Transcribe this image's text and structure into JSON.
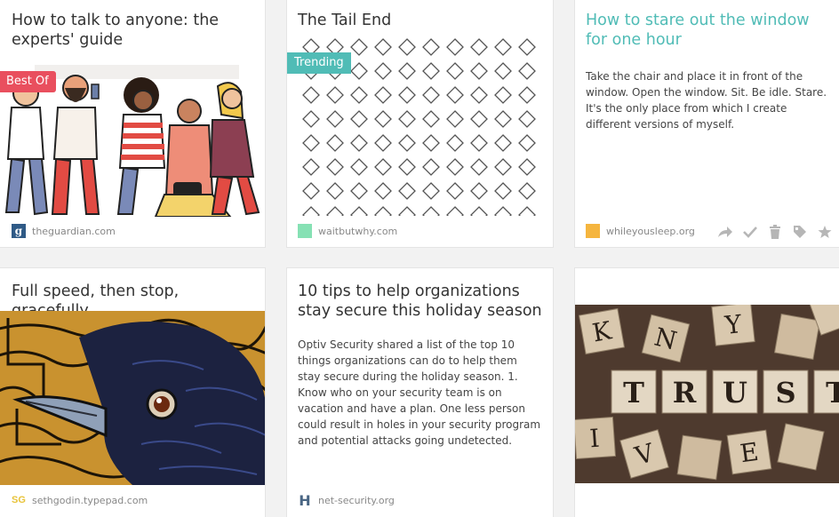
{
  "cards": [
    {
      "title": "How to talk to anyone: the experts' guide",
      "badge": "Best Of",
      "domain": "theguardian.com",
      "favicon": "g"
    },
    {
      "title": "The Tail End",
      "badge": "Trending",
      "domain": "waitbutwhy.com",
      "favicon": ""
    },
    {
      "title": "How to stare out the window for one hour",
      "excerpt": "Take the chair and place it in front of the window. Open the window. Sit. Be idle. Stare. It's the only place from which I create different versions of myself.",
      "domain": "whileyousleep.org",
      "favicon": ""
    },
    {
      "title": "Full speed, then stop, gracefully",
      "domain": "sethgodin.typepad.com",
      "favicon": "SG"
    },
    {
      "title": "10 tips to help organizations stay secure this holiday season",
      "excerpt": "Optiv Security shared a list of the top 10 things organizations can do to help them stay secure during the holiday season. 1. Know who on your security team is on vacation and have a plan. One less person could result in holes in your security program and potential attacks going undetected.",
      "domain": "net-security.org",
      "favicon": "H"
    },
    {
      "tiles_row1": [
        "K",
        "N",
        "Y"
      ],
      "tiles_trust": [
        "T",
        "R",
        "U",
        "S",
        "T"
      ],
      "tiles_row3": [
        "I",
        "V",
        "E"
      ]
    }
  ],
  "colors": {
    "accent_title": "#50bcb6",
    "best_of_badge": "#e94f5e",
    "trending_badge": "#50bcb6",
    "waitbutwhy_favicon": "#86e1b4",
    "whileyousleep_favicon": "#f5b53e",
    "sethgodin_favicon": "#e8c33a",
    "netsecurity_favicon": "#4a6684"
  },
  "actions": [
    "share-icon",
    "check-icon",
    "delete-icon",
    "tag-icon",
    "favorite-icon"
  ]
}
